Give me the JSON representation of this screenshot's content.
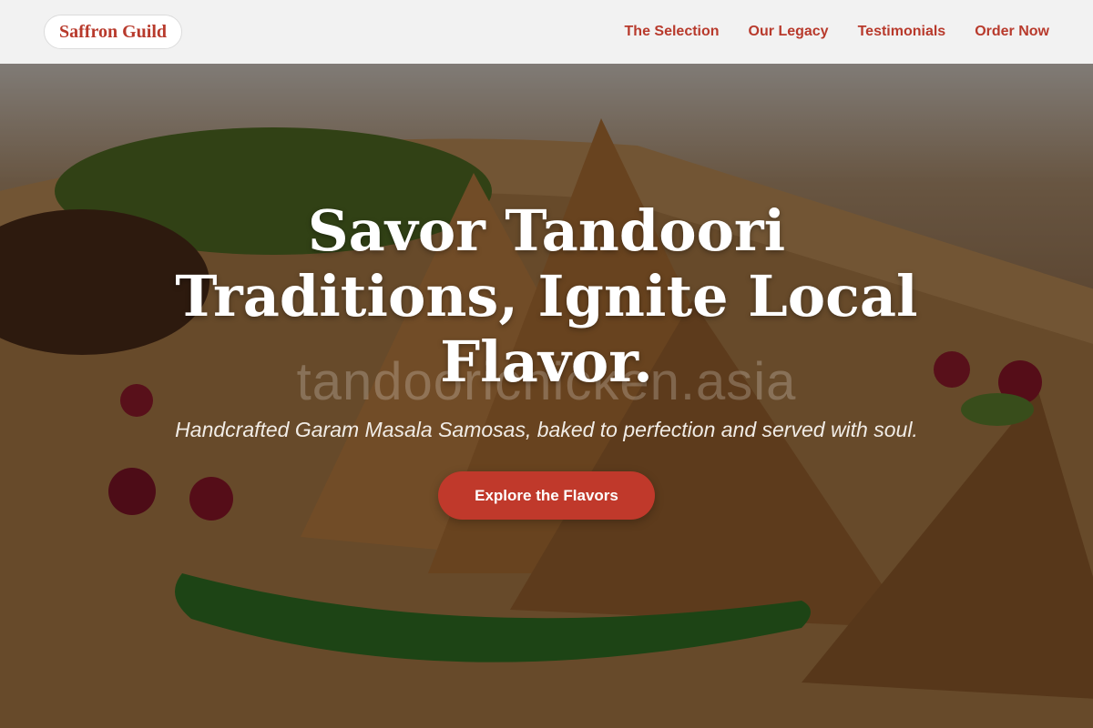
{
  "brand": {
    "name": "Saffron Guild",
    "color": "#b83a2c"
  },
  "nav": {
    "items": [
      {
        "label": "The Selection"
      },
      {
        "label": "Our Legacy"
      },
      {
        "label": "Testimonials"
      },
      {
        "label": "Order Now"
      }
    ]
  },
  "hero": {
    "title": "Savor Tandoori Traditions, Ignite Local Flavor.",
    "subtitle": "Handcrafted Garam Masala Samosas, baked to perfection and served with soul.",
    "cta_label": "Explore the Flavors",
    "cta_color": "#c0392b",
    "watermark": "tandoorichicken.asia",
    "background_subject": "samosas-on-wooden-platter"
  }
}
